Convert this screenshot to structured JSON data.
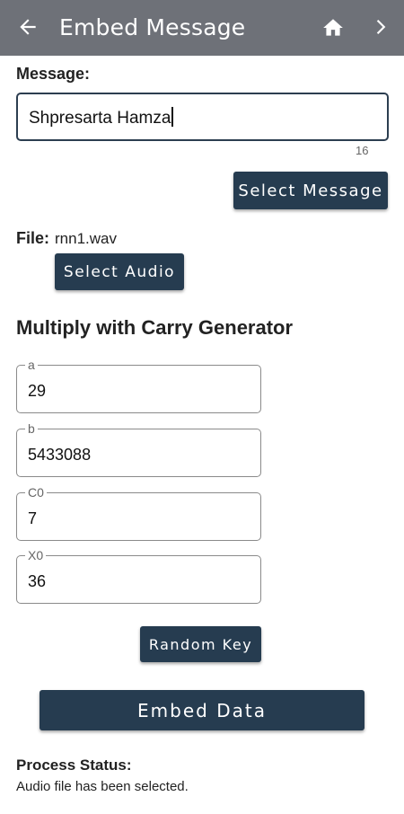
{
  "appbar": {
    "title": "Embed Message",
    "back_icon": "arrow-left-icon",
    "home_icon": "home-icon",
    "forward_icon": "chevron-right-icon",
    "background": "#6e7178"
  },
  "message": {
    "label": "Message:",
    "value": "Shpresarta Hamza",
    "char_count": "16",
    "select_button": "Select Message"
  },
  "file": {
    "label": "File:",
    "value": "rnn1.wav",
    "select_button": "Select Audio"
  },
  "generator": {
    "title": "Multiply with Carry Generator",
    "fields": [
      {
        "label": "a",
        "value": "29"
      },
      {
        "label": "b",
        "value": "5433088"
      },
      {
        "label": "C0",
        "value": "7"
      },
      {
        "label": "X0",
        "value": "36"
      }
    ],
    "random_button": "Random Key"
  },
  "embed_button": "Embed Data",
  "status": {
    "label": "Process Status:",
    "value": "Audio file has been selected."
  },
  "colors": {
    "button": "#263c50",
    "appbar": "#6e7178"
  }
}
